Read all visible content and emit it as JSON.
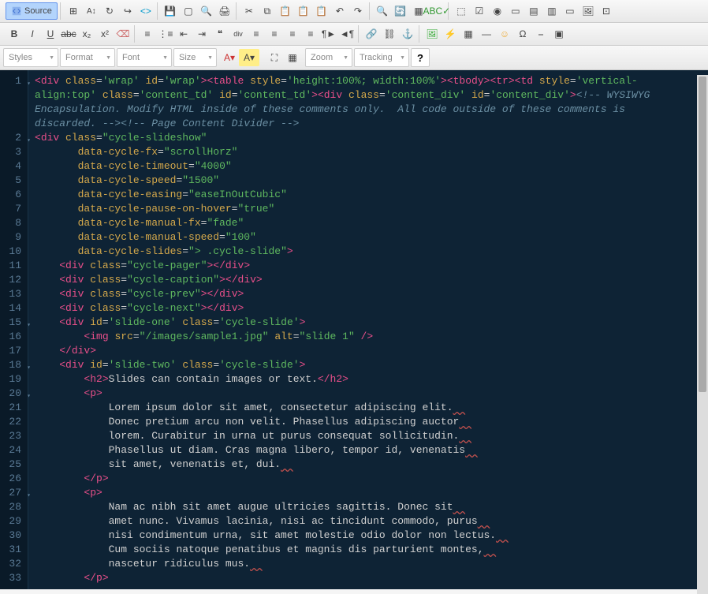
{
  "toolbar": {
    "source_label": "Source",
    "dropdowns": {
      "styles": "Styles",
      "format": "Format",
      "font": "Font",
      "size": "Size",
      "zoom": "Zoom",
      "tracking": "Tracking"
    },
    "help": "?"
  },
  "code": {
    "lines": [
      {
        "n": "1",
        "indent": "",
        "tokens": [
          [
            "<",
            "tag"
          ],
          [
            "div ",
            "tag"
          ],
          [
            "class",
            "attr"
          ],
          [
            "=",
            "eq"
          ],
          [
            "'wrap'",
            "val"
          ],
          [
            " ",
            "txt"
          ],
          [
            "id",
            "attr"
          ],
          [
            "=",
            "eq"
          ],
          [
            "'wrap'",
            "val"
          ],
          [
            "><",
            "tag"
          ],
          [
            "table ",
            "tag"
          ],
          [
            "style",
            "attr"
          ],
          [
            "=",
            "eq"
          ],
          [
            "'height:100%; width:100%'",
            "val"
          ],
          [
            "><",
            "tag"
          ],
          [
            "tbody",
            "tag"
          ],
          [
            "><",
            "tag"
          ],
          [
            "tr",
            "tag"
          ],
          [
            "><",
            "tag"
          ],
          [
            "td ",
            "tag"
          ],
          [
            "style",
            "attr"
          ],
          [
            "=",
            "eq"
          ],
          [
            "'vertical-",
            "val"
          ]
        ]
      },
      {
        "n": "",
        "indent": "",
        "tokens": [
          [
            "align:top'",
            "val"
          ],
          [
            " ",
            "txt"
          ],
          [
            "class",
            "attr"
          ],
          [
            "=",
            "eq"
          ],
          [
            "'content_td'",
            "val"
          ],
          [
            " ",
            "txt"
          ],
          [
            "id",
            "attr"
          ],
          [
            "=",
            "eq"
          ],
          [
            "'content_td'",
            "val"
          ],
          [
            "><",
            "tag"
          ],
          [
            "div ",
            "tag"
          ],
          [
            "class",
            "attr"
          ],
          [
            "=",
            "eq"
          ],
          [
            "'content_div'",
            "val"
          ],
          [
            " ",
            "txt"
          ],
          [
            "id",
            "attr"
          ],
          [
            "=",
            "eq"
          ],
          [
            "'content_div'",
            "val"
          ],
          [
            ">",
            "tag"
          ],
          [
            "<!-- WYSIWYG",
            "cmt"
          ]
        ]
      },
      {
        "n": "",
        "indent": "",
        "tokens": [
          [
            "Encapsulation. Modify HTML inside of these comments only.  All code outside of these comments is",
            "cmt"
          ]
        ]
      },
      {
        "n": "",
        "indent": "",
        "tokens": [
          [
            "discarded. -->",
            "cmt"
          ],
          [
            "<!-- Page Content Divider -->",
            "cmt"
          ]
        ]
      },
      {
        "n": "2",
        "indent": "",
        "tokens": [
          [
            "<",
            "tag"
          ],
          [
            "div ",
            "tag"
          ],
          [
            "class",
            "attr"
          ],
          [
            "=",
            "eq"
          ],
          [
            "\"cycle-slideshow\"",
            "val"
          ]
        ]
      },
      {
        "n": "3",
        "indent": "       ",
        "tokens": [
          [
            "data-cycle-fx",
            "attr"
          ],
          [
            "=",
            "eq"
          ],
          [
            "\"scrollHorz\"",
            "val"
          ]
        ]
      },
      {
        "n": "4",
        "indent": "       ",
        "tokens": [
          [
            "data-cycle-timeout",
            "attr"
          ],
          [
            "=",
            "eq"
          ],
          [
            "\"4000\"",
            "val"
          ]
        ]
      },
      {
        "n": "5",
        "indent": "       ",
        "tokens": [
          [
            "data-cycle-speed",
            "attr"
          ],
          [
            "=",
            "eq"
          ],
          [
            "\"1500\"",
            "val"
          ]
        ]
      },
      {
        "n": "6",
        "indent": "       ",
        "tokens": [
          [
            "data-cycle-easing",
            "attr"
          ],
          [
            "=",
            "eq"
          ],
          [
            "\"easeInOutCubic\"",
            "val"
          ]
        ]
      },
      {
        "n": "7",
        "indent": "       ",
        "tokens": [
          [
            "data-cycle-pause-on-hover",
            "attr"
          ],
          [
            "=",
            "eq"
          ],
          [
            "\"true\"",
            "val"
          ]
        ]
      },
      {
        "n": "8",
        "indent": "       ",
        "tokens": [
          [
            "data-cycle-manual-fx",
            "attr"
          ],
          [
            "=",
            "eq"
          ],
          [
            "\"fade\"",
            "val"
          ]
        ]
      },
      {
        "n": "9",
        "indent": "       ",
        "tokens": [
          [
            "data-cycle-manual-speed",
            "attr"
          ],
          [
            "=",
            "eq"
          ],
          [
            "\"100\"",
            "val"
          ]
        ]
      },
      {
        "n": "10",
        "indent": "       ",
        "tokens": [
          [
            "data-cycle-slides",
            "attr"
          ],
          [
            "=",
            "eq"
          ],
          [
            "\"> .cycle-slide\"",
            "val"
          ],
          [
            ">",
            "tag"
          ]
        ]
      },
      {
        "n": "11",
        "indent": "    ",
        "tokens": [
          [
            "<",
            "tag"
          ],
          [
            "div ",
            "tag"
          ],
          [
            "class",
            "attr"
          ],
          [
            "=",
            "eq"
          ],
          [
            "\"cycle-pager\"",
            "val"
          ],
          [
            "></",
            "tag"
          ],
          [
            "div",
            "tag"
          ],
          [
            ">",
            "tag"
          ]
        ]
      },
      {
        "n": "12",
        "indent": "    ",
        "tokens": [
          [
            "<",
            "tag"
          ],
          [
            "div ",
            "tag"
          ],
          [
            "class",
            "attr"
          ],
          [
            "=",
            "eq"
          ],
          [
            "\"cycle-caption\"",
            "val"
          ],
          [
            "></",
            "tag"
          ],
          [
            "div",
            "tag"
          ],
          [
            ">",
            "tag"
          ]
        ]
      },
      {
        "n": "13",
        "indent": "    ",
        "tokens": [
          [
            "<",
            "tag"
          ],
          [
            "div ",
            "tag"
          ],
          [
            "class",
            "attr"
          ],
          [
            "=",
            "eq"
          ],
          [
            "\"cycle-prev\"",
            "val"
          ],
          [
            "></",
            "tag"
          ],
          [
            "div",
            "tag"
          ],
          [
            ">",
            "tag"
          ]
        ]
      },
      {
        "n": "14",
        "indent": "    ",
        "tokens": [
          [
            "<",
            "tag"
          ],
          [
            "div ",
            "tag"
          ],
          [
            "class",
            "attr"
          ],
          [
            "=",
            "eq"
          ],
          [
            "\"cycle-next\"",
            "val"
          ],
          [
            "></",
            "tag"
          ],
          [
            "div",
            "tag"
          ],
          [
            ">",
            "tag"
          ]
        ]
      },
      {
        "n": "15",
        "indent": "    ",
        "tokens": [
          [
            "<",
            "tag"
          ],
          [
            "div ",
            "tag"
          ],
          [
            "id",
            "attr"
          ],
          [
            "=",
            "eq"
          ],
          [
            "'slide-one'",
            "val"
          ],
          [
            " ",
            "txt"
          ],
          [
            "class",
            "attr"
          ],
          [
            "=",
            "eq"
          ],
          [
            "'cycle-slide'",
            "val"
          ],
          [
            ">",
            "tag"
          ]
        ]
      },
      {
        "n": "16",
        "indent": "        ",
        "tokens": [
          [
            "<",
            "tag"
          ],
          [
            "img ",
            "tag"
          ],
          [
            "src",
            "attr"
          ],
          [
            "=",
            "eq"
          ],
          [
            "\"/images/sample1.jpg\"",
            "val"
          ],
          [
            " ",
            "txt"
          ],
          [
            "alt",
            "attr"
          ],
          [
            "=",
            "eq"
          ],
          [
            "\"slide 1\"",
            "val"
          ],
          [
            " />",
            "tag"
          ]
        ]
      },
      {
        "n": "17",
        "indent": "    ",
        "tokens": [
          [
            "</",
            "tag"
          ],
          [
            "div",
            "tag"
          ],
          [
            ">",
            "tag"
          ]
        ]
      },
      {
        "n": "18",
        "indent": "    ",
        "tokens": [
          [
            "<",
            "tag"
          ],
          [
            "div ",
            "tag"
          ],
          [
            "id",
            "attr"
          ],
          [
            "=",
            "eq"
          ],
          [
            "'slide-two'",
            "val"
          ],
          [
            " ",
            "txt"
          ],
          [
            "class",
            "attr"
          ],
          [
            "=",
            "eq"
          ],
          [
            "'cycle-slide'",
            "val"
          ],
          [
            ">",
            "tag"
          ]
        ]
      },
      {
        "n": "19",
        "indent": "        ",
        "tokens": [
          [
            "<",
            "tag"
          ],
          [
            "h2",
            "tag"
          ],
          [
            ">",
            "tag"
          ],
          [
            "Slides can contain images or text.",
            "txt"
          ],
          [
            "</",
            "tag"
          ],
          [
            "h2",
            "tag"
          ],
          [
            ">",
            "tag"
          ]
        ]
      },
      {
        "n": "20",
        "indent": "        ",
        "tokens": [
          [
            "<",
            "tag"
          ],
          [
            "p",
            "tag"
          ],
          [
            ">",
            "tag"
          ]
        ]
      },
      {
        "n": "21",
        "indent": "            ",
        "tokens": [
          [
            "Lorem ipsum dolor sit amet, consectetur adipiscing elit.",
            "txt"
          ]
        ],
        "sp": true
      },
      {
        "n": "22",
        "indent": "            ",
        "tokens": [
          [
            "Donec pretium arcu non velit. Phasellus adipiscing auctor",
            "txt"
          ]
        ],
        "sp": true
      },
      {
        "n": "23",
        "indent": "            ",
        "tokens": [
          [
            "lorem. Curabitur in urna ut purus consequat sollicitudin.",
            "txt"
          ]
        ],
        "sp": true
      },
      {
        "n": "24",
        "indent": "            ",
        "tokens": [
          [
            "Phasellus ut diam. Cras magna libero, tempor id, venenatis",
            "txt"
          ]
        ],
        "sp": true
      },
      {
        "n": "25",
        "indent": "            ",
        "tokens": [
          [
            "sit amet, venenatis et, dui.",
            "txt"
          ]
        ],
        "sp": true
      },
      {
        "n": "26",
        "indent": "        ",
        "tokens": [
          [
            "</",
            "tag"
          ],
          [
            "p",
            "tag"
          ],
          [
            ">",
            "tag"
          ]
        ]
      },
      {
        "n": "27",
        "indent": "        ",
        "tokens": [
          [
            "<",
            "tag"
          ],
          [
            "p",
            "tag"
          ],
          [
            ">",
            "tag"
          ]
        ]
      },
      {
        "n": "28",
        "indent": "            ",
        "tokens": [
          [
            "Nam ac nibh sit amet augue ultricies sagittis. Donec sit",
            "txt"
          ]
        ],
        "sp": true
      },
      {
        "n": "29",
        "indent": "            ",
        "tokens": [
          [
            "amet nunc. Vivamus lacinia, nisi ac tincidunt commodo, purus",
            "txt"
          ]
        ],
        "sp": true
      },
      {
        "n": "30",
        "indent": "            ",
        "tokens": [
          [
            "nisi condimentum urna, sit amet molestie odio dolor non lectus.",
            "txt"
          ]
        ],
        "sp": true
      },
      {
        "n": "31",
        "indent": "            ",
        "tokens": [
          [
            "Cum sociis natoque penatibus et magnis dis parturient montes,",
            "txt"
          ]
        ],
        "sp": true
      },
      {
        "n": "32",
        "indent": "            ",
        "tokens": [
          [
            "nascetur ridiculus mus.",
            "txt"
          ]
        ],
        "sp": true
      },
      {
        "n": "33",
        "indent": "        ",
        "tokens": [
          [
            "</",
            "tag"
          ],
          [
            "p",
            "tag"
          ],
          [
            ">",
            "tag"
          ]
        ]
      }
    ]
  }
}
